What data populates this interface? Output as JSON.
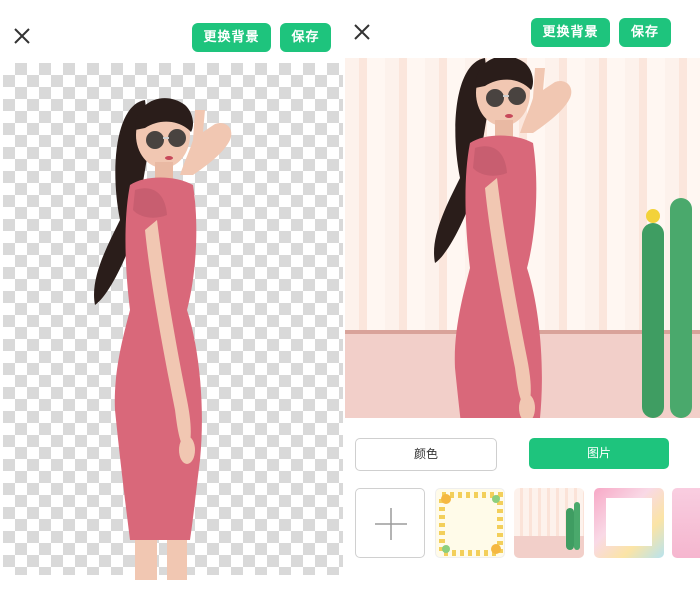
{
  "left_panel": {
    "close_icon": "close-icon",
    "change_background_label": "更换背景",
    "save_label": "保存"
  },
  "right_panel": {
    "close_icon": "close-icon",
    "change_background_label": "更换背景",
    "save_label": "保存",
    "tabs": [
      {
        "label": "颜色",
        "selected": false
      },
      {
        "label": "图片",
        "selected": true
      }
    ],
    "thumbnails": [
      {
        "kind": "add",
        "icon": "plus-icon"
      },
      {
        "kind": "background",
        "theme": "floral-frame"
      },
      {
        "kind": "background",
        "theme": "cactus-room"
      },
      {
        "kind": "background",
        "theme": "pink-frame"
      },
      {
        "kind": "background",
        "theme": "partial"
      }
    ]
  },
  "colors": {
    "accent": "#1ec47d",
    "dress": "#d9687a",
    "floor": "#f2cfc9"
  }
}
